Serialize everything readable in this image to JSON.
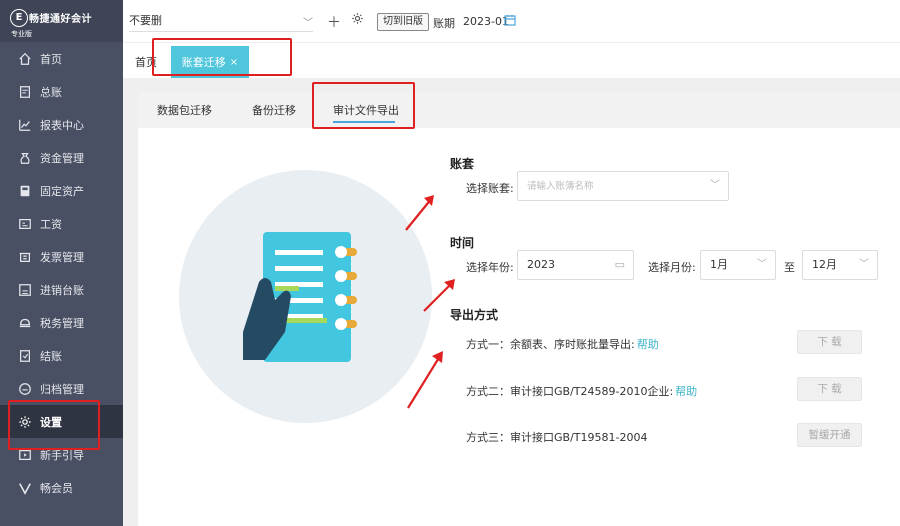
{
  "brand": {
    "logo_glyph": "E",
    "name": "畅捷通好会计",
    "edition": "专业版"
  },
  "sidebar": {
    "items": [
      {
        "label": "首页",
        "icon": "home-icon"
      },
      {
        "label": "总账",
        "icon": "ledger-icon"
      },
      {
        "label": "报表中心",
        "icon": "chart-icon"
      },
      {
        "label": "资金管理",
        "icon": "money-bag-icon"
      },
      {
        "label": "固定资产",
        "icon": "asset-icon"
      },
      {
        "label": "工资",
        "icon": "salary-icon"
      },
      {
        "label": "发票管理",
        "icon": "invoice-icon"
      },
      {
        "label": "进销台账",
        "icon": "inventory-icon"
      },
      {
        "label": "税务管理",
        "icon": "tax-icon"
      },
      {
        "label": "结账",
        "icon": "closing-icon"
      },
      {
        "label": "归档管理",
        "icon": "archive-icon"
      },
      {
        "label": "设置",
        "icon": "gear-icon",
        "active": true
      },
      {
        "label": "新手引导",
        "icon": "guide-icon"
      },
      {
        "label": "畅会员",
        "icon": "vip-icon"
      }
    ]
  },
  "topbar": {
    "company": "不要删",
    "old_version_button": "切到旧版",
    "period_label": "账期",
    "period_value": "2023-01"
  },
  "tabs": {
    "home": "首页",
    "active": "账套迁移",
    "close": "×"
  },
  "subtabs": [
    "数据包迁移",
    "备份迁移",
    "审计文件导出"
  ],
  "form": {
    "account_section": "账套",
    "select_account_label": "选择账套:",
    "select_account_placeholder": "请输入账簿名称",
    "time_section": "时间",
    "year_label": "选择年份:",
    "year_value": "2023",
    "month_label": "选择月份:",
    "month_from": "1月",
    "to_label": "至",
    "month_to": "12月",
    "export_section": "导出方式",
    "methods": [
      {
        "text": "方式一：余额表、序时账批量导出:",
        "help": "帮助",
        "button": "下 载"
      },
      {
        "text": "方式二：审计接口GB/T24589-2010企业:",
        "help": "帮助",
        "button": "下 载"
      },
      {
        "text": "方式三：审计接口GB/T19581-2004",
        "help": "",
        "button": "暂缓开通"
      }
    ]
  },
  "colors": {
    "sidebar_bg": "#4a5064",
    "accent": "#4fc6dc",
    "link": "#3ab3c9",
    "annotation_red": "#e02020"
  }
}
